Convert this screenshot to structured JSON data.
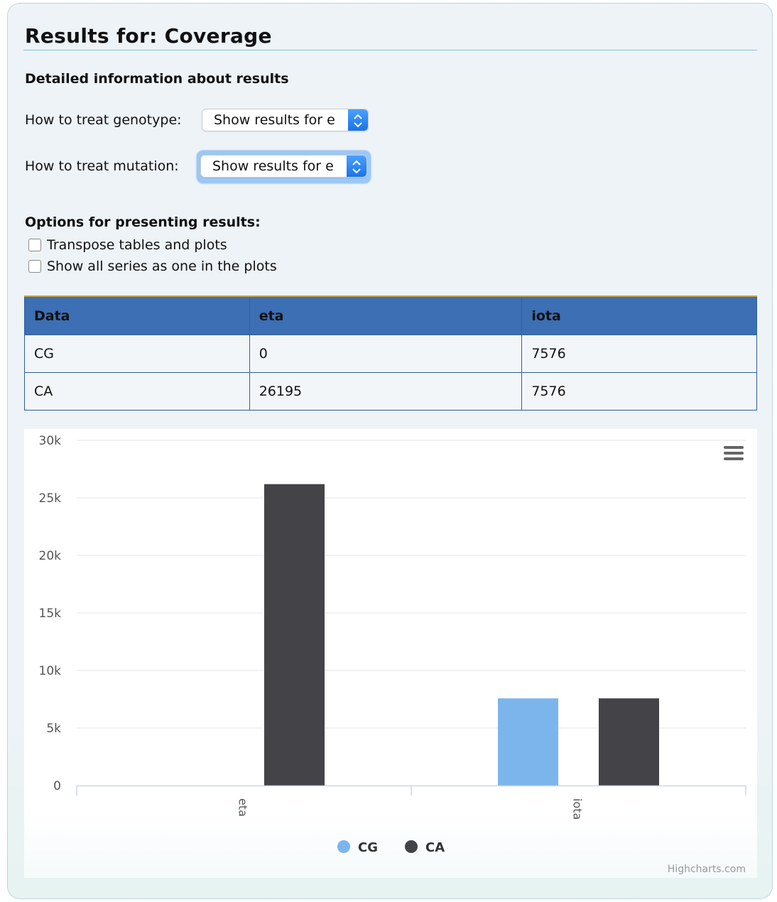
{
  "page": {
    "title": "Results for: Coverage",
    "subheading": "Detailed information about results"
  },
  "controls": {
    "genotype": {
      "label": "How to treat genotype:",
      "value": "Show results for ea"
    },
    "mutation": {
      "label": "How to treat mutation:",
      "value": "Show results for ea"
    }
  },
  "options": {
    "heading": "Options for presenting results:",
    "transpose": {
      "label": "Transpose tables and plots",
      "checked": false
    },
    "one_series": {
      "label": "Show all series as one in the plots",
      "checked": false
    }
  },
  "table": {
    "headers": [
      "Data",
      "eta",
      "iota"
    ],
    "rows": [
      [
        "CG",
        "0",
        "7576"
      ],
      [
        "CA",
        "26195",
        "7576"
      ]
    ]
  },
  "chart_data": {
    "type": "bar",
    "categories": [
      "eta",
      "iota"
    ],
    "series": [
      {
        "name": "CG",
        "values": [
          0,
          7576
        ],
        "color": "#7cb5ec"
      },
      {
        "name": "CA",
        "values": [
          26195,
          7576
        ],
        "color": "#434348"
      }
    ],
    "ylim": [
      0,
      30000
    ],
    "yticks": [
      "0",
      "5k",
      "10k",
      "15k",
      "20k",
      "25k",
      "30k"
    ],
    "grid": true,
    "legend": "bottom-center",
    "credits": "Highcharts.com",
    "menu_icon": "hamburger-menu-icon"
  }
}
